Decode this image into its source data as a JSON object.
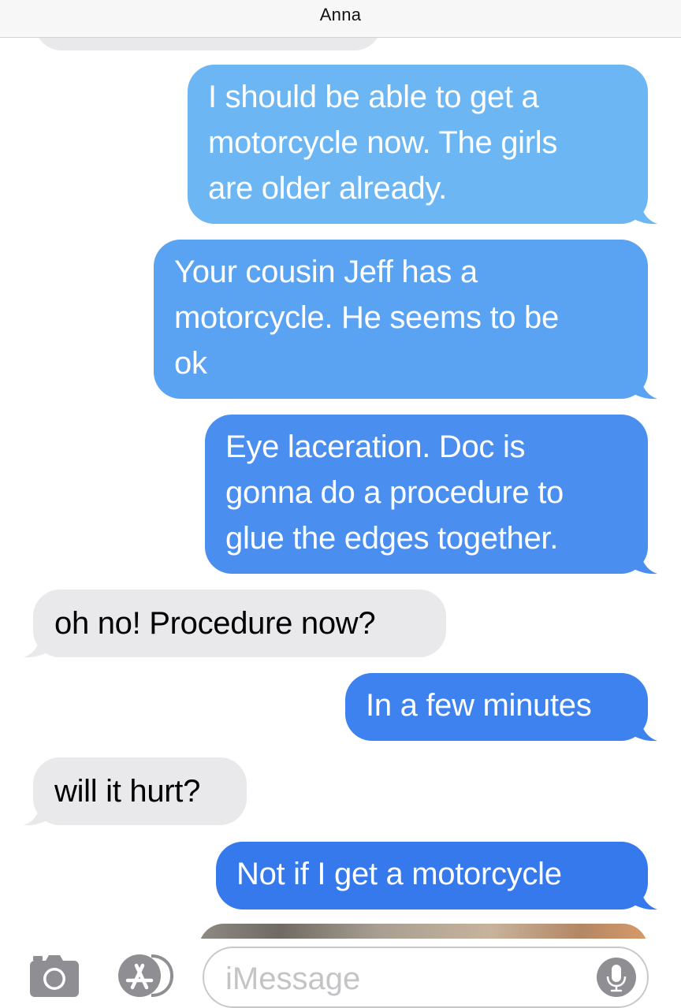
{
  "header": {
    "title": "Anna"
  },
  "messages": [
    {
      "from": "me",
      "text": "I should be able to get a\nmotorcycle now. The girls\nare older already.",
      "color": "#6cb6f4"
    },
    {
      "from": "me",
      "text": "Your cousin Jeff has a\nmotorcycle. He seems to be\nok",
      "color": "#5aa2f2"
    },
    {
      "from": "me",
      "text": "Eye laceration. Doc is\ngonna do a procedure to\nglue the edges together.",
      "color": "#4a8ff0"
    },
    {
      "from": "them",
      "text": "oh no! Procedure now?"
    },
    {
      "from": "me",
      "text": "In a few minutes",
      "color": "#3d82ee"
    },
    {
      "from": "them",
      "text": "will it hurt?"
    },
    {
      "from": "me",
      "text": "Not if I get a motorcycle",
      "color": "#3579ec"
    }
  ],
  "composer": {
    "placeholder": "iMessage",
    "camera_icon": "camera-icon",
    "apps_icon": "app-store-icon",
    "mic_icon": "microphone-icon"
  },
  "colors": {
    "received_bubble": "#e9e9eb",
    "received_text": "#000000",
    "sent_text": "#ffffff",
    "icon_gray": "#8e8e93"
  }
}
